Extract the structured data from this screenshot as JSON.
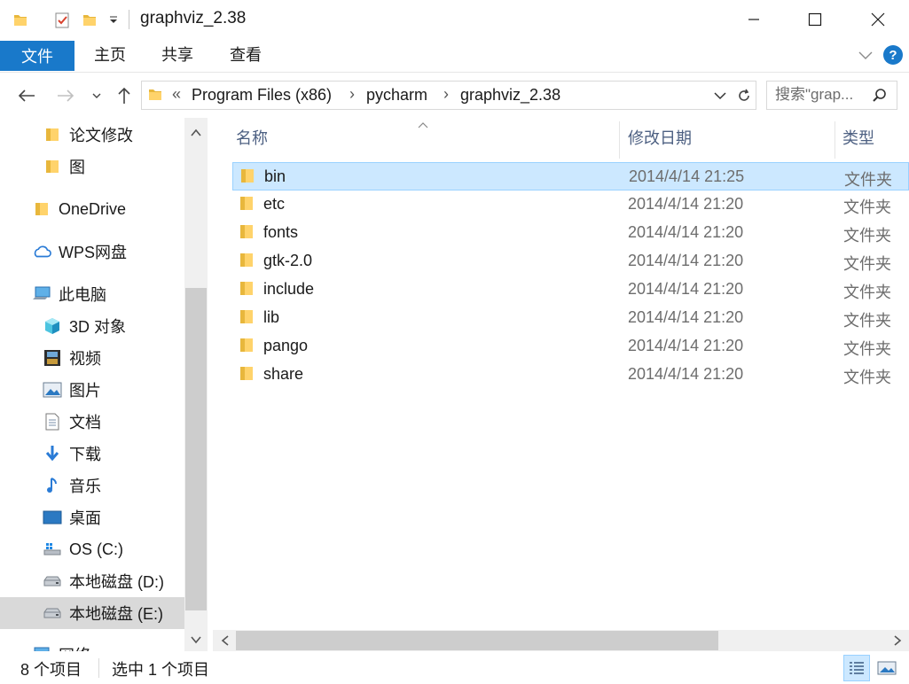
{
  "window": {
    "title": "graphviz_2.38",
    "controls": {
      "minimize": "—",
      "maximize": "☐",
      "close": "✕"
    }
  },
  "ribbon": {
    "tabs": [
      {
        "label": "文件"
      },
      {
        "label": "主页"
      },
      {
        "label": "共享"
      },
      {
        "label": "查看"
      }
    ],
    "help_label": "?"
  },
  "address": {
    "overflow": "«",
    "crumbs": [
      "Program Files (x86)",
      "pycharm",
      "graphviz_2.38"
    ],
    "separator": "›"
  },
  "search": {
    "placeholder": "搜索\"grap..."
  },
  "navigation": {
    "items": [
      {
        "label": "论文修改",
        "icon": "folder-icon"
      },
      {
        "label": "图",
        "icon": "folder-icon"
      },
      {
        "label": "OneDrive",
        "icon": "folder-icon"
      },
      {
        "label": "WPS网盘",
        "icon": "cloud-icon"
      },
      {
        "label": "此电脑",
        "icon": "computer-icon"
      },
      {
        "label": "3D 对象",
        "icon": "cube-icon"
      },
      {
        "label": "视频",
        "icon": "video-icon"
      },
      {
        "label": "图片",
        "icon": "picture-icon"
      },
      {
        "label": "文档",
        "icon": "document-icon"
      },
      {
        "label": "下载",
        "icon": "download-icon"
      },
      {
        "label": "音乐",
        "icon": "music-icon"
      },
      {
        "label": "桌面",
        "icon": "desktop-icon"
      },
      {
        "label": "OS (C:)",
        "icon": "windows-drive-icon"
      },
      {
        "label": "本地磁盘 (D:)",
        "icon": "drive-icon"
      },
      {
        "label": "本地磁盘 (E:)",
        "icon": "drive-icon",
        "selected": true
      },
      {
        "label": "网络",
        "icon": "network-icon"
      }
    ]
  },
  "file_list": {
    "columns": {
      "name": "名称",
      "date": "修改日期",
      "type": "类型"
    },
    "rows": [
      {
        "name": "bin",
        "date": "2014/4/14 21:25",
        "type": "文件夹",
        "selected": true
      },
      {
        "name": "etc",
        "date": "2014/4/14 21:20",
        "type": "文件夹"
      },
      {
        "name": "fonts",
        "date": "2014/4/14 21:20",
        "type": "文件夹"
      },
      {
        "name": "gtk-2.0",
        "date": "2014/4/14 21:20",
        "type": "文件夹"
      },
      {
        "name": "include",
        "date": "2014/4/14 21:20",
        "type": "文件夹"
      },
      {
        "name": "lib",
        "date": "2014/4/14 21:20",
        "type": "文件夹"
      },
      {
        "name": "pango",
        "date": "2014/4/14 21:20",
        "type": "文件夹"
      },
      {
        "name": "share",
        "date": "2014/4/14 21:20",
        "type": "文件夹"
      }
    ]
  },
  "status": {
    "item_count": "8 个项目",
    "selected_count": "选中 1 个项目"
  },
  "colors": {
    "accent": "#1979ca",
    "selection_bg": "#cce8ff",
    "selection_border": "#99d1ff",
    "folder_yellow": "#ffd36b",
    "header_text": "#4d6082"
  }
}
